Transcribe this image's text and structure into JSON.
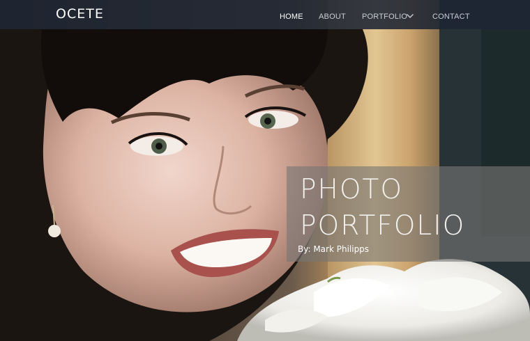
{
  "site": {
    "brand": "OCETE"
  },
  "nav": {
    "items": [
      {
        "label": "HOME",
        "active": true
      },
      {
        "label": "ABOUT",
        "active": false
      },
      {
        "label": "PORTFOLIO",
        "active": false,
        "has_dropdown": true
      },
      {
        "label": "CONTACT",
        "active": false
      }
    ]
  },
  "hero": {
    "title_line1": "PHOTO",
    "title_line2": "PORTFOLIO",
    "byline": "By: Mark Philipps",
    "image_subject": "smiling woman with dark fringe holding white calla lilies"
  },
  "colors": {
    "navbar_bg": "#1c2432",
    "nav_text": "#c9ced6",
    "nav_active": "#ffffff",
    "overlay_bg": "#787674",
    "title_text": "#f3f1ee"
  },
  "icons": {
    "dropdown": "chevron-down-icon"
  }
}
